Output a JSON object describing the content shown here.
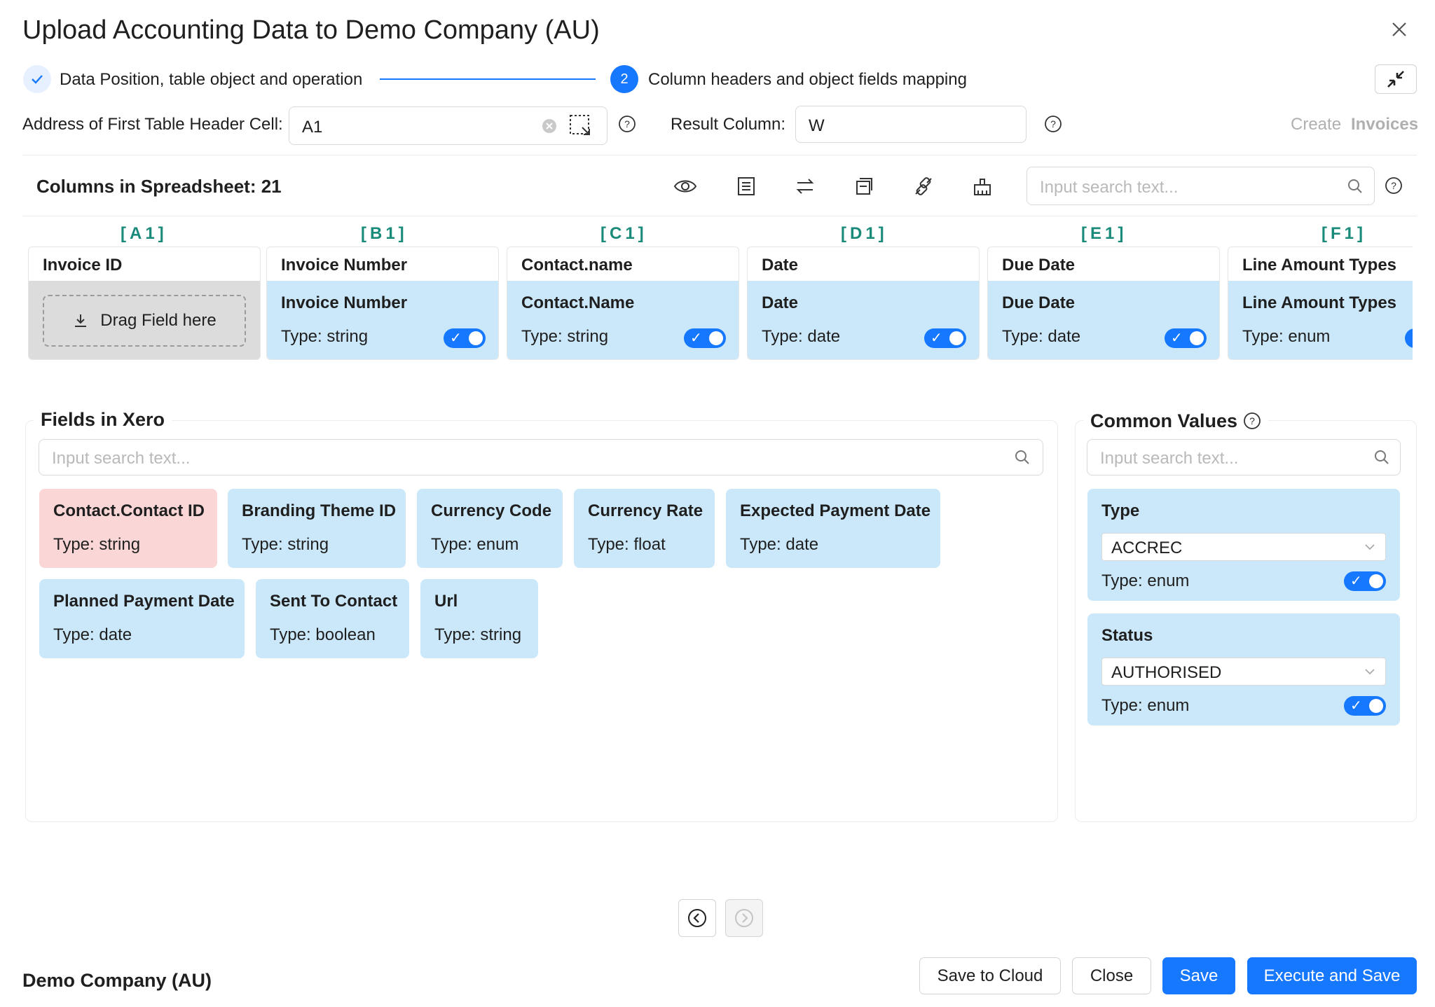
{
  "dialog": {
    "title": "Upload Accounting Data to Demo Company (AU)"
  },
  "steps": [
    {
      "label": "Data Position, table object and operation",
      "status": "done"
    },
    {
      "number": "2",
      "label": "Column headers and object fields mapping",
      "status": "active"
    }
  ],
  "address": {
    "label": "Address of First Table Header Cell:",
    "value": "A1"
  },
  "result": {
    "label": "Result Column:",
    "value": "W"
  },
  "create_action": {
    "word1": "Create",
    "word2": "Invoices"
  },
  "columns_bar": {
    "title": "Columns in Spreadsheet: 21",
    "search_placeholder": "Input search text..."
  },
  "columns": [
    {
      "ref": "[A1]",
      "header": "Invoice ID",
      "mapped": false,
      "drop_label": "Drag Field here"
    },
    {
      "ref": "[B1]",
      "header": "Invoice Number",
      "mapped": true,
      "field": "Invoice Number",
      "type": "Type: string",
      "enabled": true
    },
    {
      "ref": "[C1]",
      "header": "Contact.name",
      "mapped": true,
      "field": "Contact.Name",
      "type": "Type: string",
      "enabled": true
    },
    {
      "ref": "[D1]",
      "header": "Date",
      "mapped": true,
      "field": "Date",
      "type": "Type: date",
      "enabled": true
    },
    {
      "ref": "[E1]",
      "header": "Due Date",
      "mapped": true,
      "field": "Due Date",
      "type": "Type: date",
      "enabled": true
    },
    {
      "ref": "[F1]",
      "header": "Line Amount Types",
      "mapped": true,
      "field": "Line Amount Types",
      "type": "Type: enum",
      "enabled": true
    }
  ],
  "fields_panel": {
    "title": "Fields in Xero",
    "search_placeholder": "Input search text...",
    "fields": [
      {
        "name": "Contact.Contact ID",
        "type": "Type: string",
        "required": true
      },
      {
        "name": "Branding Theme ID",
        "type": "Type: string",
        "required": false
      },
      {
        "name": "Currency Code",
        "type": "Type: enum",
        "required": false
      },
      {
        "name": "Currency Rate",
        "type": "Type: float",
        "required": false
      },
      {
        "name": "Expected Payment Date",
        "type": "Type: date",
        "required": false
      },
      {
        "name": "Planned Payment Date",
        "type": "Type: date",
        "required": false
      },
      {
        "name": "Sent To Contact",
        "type": "Type: boolean",
        "required": false
      },
      {
        "name": "Url",
        "type": "Type: string",
        "required": false
      }
    ]
  },
  "common_values": {
    "title": "Common Values",
    "search_placeholder": "Input search text...",
    "items": [
      {
        "label": "Type",
        "value": "ACCREC",
        "type": "Type: enum",
        "enabled": true
      },
      {
        "label": "Status",
        "value": "AUTHORISED",
        "type": "Type: enum",
        "enabled": true
      }
    ]
  },
  "footer": {
    "company": "Demo Company (AU)",
    "save_cloud": "Save to Cloud",
    "close": "Close",
    "save": "Save",
    "execute_save": "Execute and Save"
  },
  "colors": {
    "primary": "#1677ff",
    "mapped_bg": "#cbe8fb",
    "required_bg": "#fbd6d6",
    "column_ref": "#1a8a7a"
  }
}
